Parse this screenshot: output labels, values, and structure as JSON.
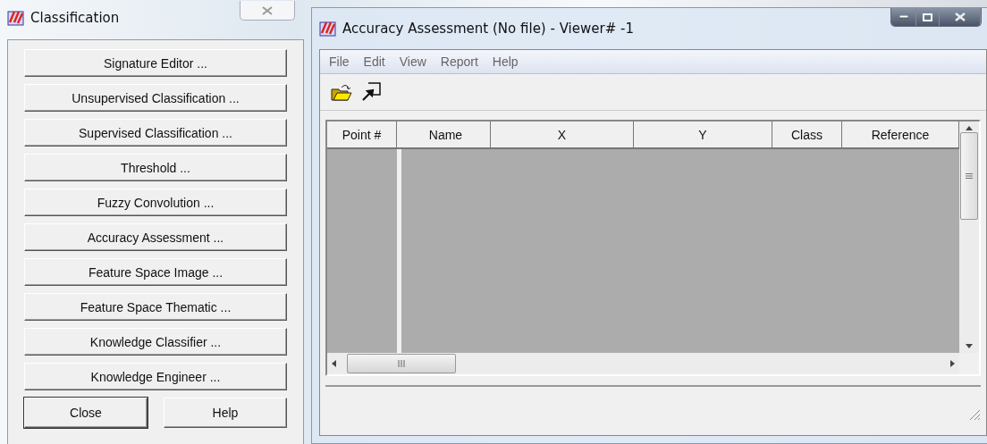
{
  "classification": {
    "title": "Classification",
    "buttons": [
      "Signature Editor ...",
      "Unsupervised Classification ...",
      "Supervised Classification ...",
      "Threshold ...",
      "Fuzzy Convolution ...",
      "Accuracy Assessment ...",
      "Feature Space Image ...",
      "Feature Space Thematic ...",
      "Knowledge Classifier ...",
      "Knowledge Engineer ..."
    ],
    "footer_buttons": [
      "Close",
      "Help"
    ]
  },
  "accuracy_window": {
    "title": "Accuracy Assessment (No file) - Viewer# -1",
    "menu": [
      "File",
      "Edit",
      "View",
      "Report",
      "Help"
    ],
    "table": {
      "columns": [
        "Point #",
        "Name",
        "X",
        "Y",
        "Class",
        "Reference"
      ]
    }
  }
}
